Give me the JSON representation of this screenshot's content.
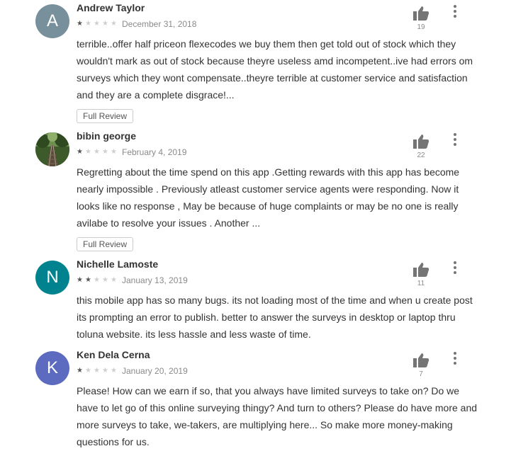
{
  "reviews": [
    {
      "author": "Andrew Taylor",
      "avatar_letter": "A",
      "avatar_color": "#78909c",
      "rating": 1,
      "date": "December 31, 2018",
      "text": "terrible..offer half priceon flexecodes we buy them then get told out of stock which they wouldn't mark as out of stock because theyre useless amd incompetent..ive had errors om surveys which they wont compensate..theyre terrible at customer service and satisfaction and they are a complete disgrace!...",
      "full_review_label": "Full Review",
      "helpful_count": "19"
    },
    {
      "author": "bibin george",
      "avatar_letter": "",
      "avatar_color": "#4a6a3a",
      "rating": 1,
      "date": "February 4, 2019",
      "text": "Regretting about the time spend on this app .Getting rewards with this app has become nearly impossible . Previously atleast customer service agents were responding. Now it looks like no response , May be because of huge complaints or may be no one is really avilabe to resolve your issues . Another ...",
      "full_review_label": "Full Review",
      "helpful_count": "22"
    },
    {
      "author": "Nichelle Lamoste",
      "avatar_letter": "N",
      "avatar_color": "#00838f",
      "rating": 2,
      "date": "January 13, 2019",
      "text": "this mobile app has so many bugs. its not loading most of the time and when u create post its prompting an error to publish. better to answer the surveys in desktop or laptop thru toluna website. its less hassle and less waste of time.",
      "helpful_count": "11"
    },
    {
      "author": "Ken Dela Cerna",
      "avatar_letter": "K",
      "avatar_color": "#5c6bc0",
      "rating": 1,
      "date": "January 20, 2019",
      "text": "Please! How can we earn if so, that you always have limited surveys to take on? Do we have to let go of this online surveying thingy? And turn to others? Please do have more and more surveys to take, we-takers, are multiplying here... So make more money-making questions for us.",
      "helpful_count": "7"
    }
  ]
}
